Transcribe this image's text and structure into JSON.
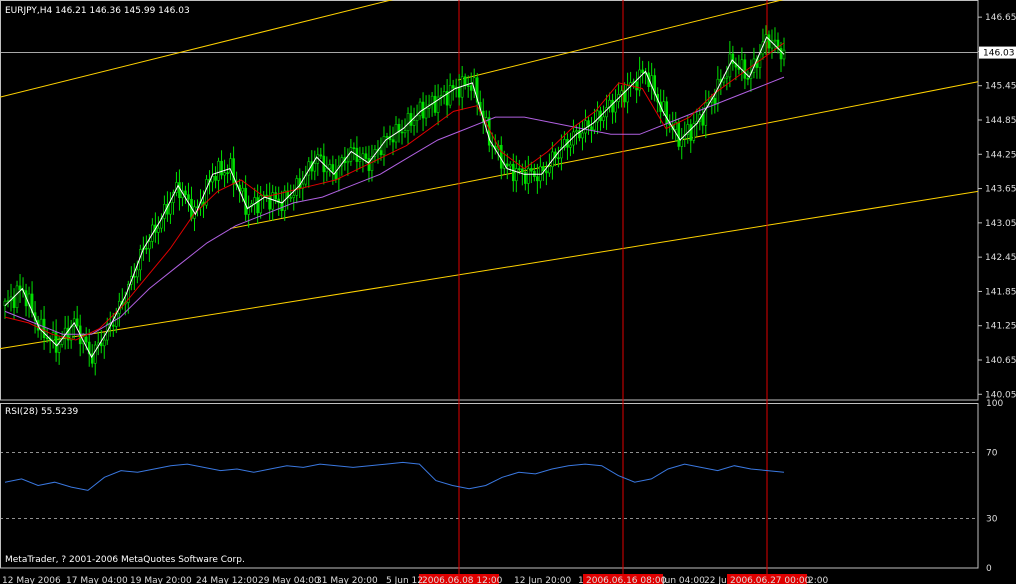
{
  "chart_data": [
    {
      "type": "candlestick",
      "title": "EURJPY,H4  146.21 146.36 145.99 146.03",
      "current_price": 146.03,
      "y_ticks": [
        140.05,
        140.65,
        141.25,
        141.85,
        142.45,
        143.05,
        143.65,
        144.25,
        144.85,
        145.45,
        146.05,
        146.65
      ],
      "y_tick_labels": [
        "140.05",
        "140.65",
        "141.25",
        "141.85",
        "142.45",
        "143.05",
        "143.65",
        "144.25",
        "144.85",
        "145.45",
        "146.05",
        "146.65"
      ],
      "current_price_label": "146.03",
      "ylim": [
        139.95,
        146.95
      ],
      "x_tick_labels": [
        "12 May 2006",
        "17 May 04:00",
        "19 May 20:00",
        "24 May 12:00",
        "29 May 04:00",
        "31 May 20:00",
        "5 Jun 12",
        "12 Jun 20:00",
        "1",
        "Jun 04:00",
        "22 Ju",
        "2:00"
      ],
      "vertical_marker_labels": [
        "2006.06.08 12:00",
        "2006.06.16 08:00",
        "2006.06.27 00:00"
      ],
      "close_path": [
        141.6,
        141.9,
        141.2,
        140.9,
        141.3,
        140.7,
        141.2,
        141.8,
        142.6,
        143.1,
        143.7,
        143.2,
        143.9,
        144.0,
        143.3,
        143.5,
        143.4,
        143.7,
        144.2,
        143.9,
        144.3,
        144.1,
        144.5,
        144.7,
        145.0,
        145.2,
        145.4,
        145.5,
        144.5,
        144.0,
        143.9,
        143.9,
        144.3,
        144.6,
        144.8,
        145.1,
        145.4,
        145.7,
        145.0,
        144.5,
        144.8,
        145.3,
        145.9,
        145.6,
        146.3,
        146.0
      ],
      "ema_fast": [
        141.4,
        141.3,
        141.1,
        141.0,
        141.2,
        141.6,
        142.1,
        142.6,
        143.2,
        143.6,
        143.8,
        143.5,
        143.6,
        143.7,
        143.8,
        144.0,
        144.2,
        144.4,
        144.7,
        145.0,
        145.1,
        144.3,
        144.0,
        144.3,
        144.7,
        145.0,
        145.5,
        145.4,
        144.7,
        144.9,
        145.3,
        145.6,
        145.9,
        146.2
      ],
      "ema_slow": [
        141.5,
        141.3,
        141.1,
        141.1,
        141.4,
        141.9,
        142.3,
        142.7,
        143.0,
        143.2,
        143.4,
        143.5,
        143.7,
        143.9,
        144.2,
        144.5,
        144.7,
        144.9,
        144.9,
        144.8,
        144.7,
        144.6,
        144.6,
        144.8,
        145.0,
        145.2,
        145.4,
        145.6
      ]
    },
    {
      "type": "line",
      "title": "RSI(28) 55.5239",
      "series": [
        {
          "name": "RSI(28)",
          "values": [
            52,
            54,
            50,
            52,
            49,
            47,
            55,
            59,
            58,
            60,
            62,
            63,
            61,
            59,
            60,
            58,
            60,
            62,
            61,
            63,
            62,
            61,
            62,
            63,
            64,
            63,
            53,
            50,
            48,
            50,
            55,
            58,
            57,
            60,
            62,
            63,
            62,
            56,
            52,
            54,
            60,
            63,
            61,
            59,
            62,
            60,
            59,
            58
          ]
        }
      ],
      "y_tick_labels": [
        "100",
        "70",
        "30",
        "0"
      ],
      "ylim": [
        0,
        100
      ],
      "levels": [
        70,
        30
      ]
    }
  ],
  "footer": {
    "copyright": "MetaTrader, ? 2001-2006 MetaQuotes Software Corp."
  }
}
